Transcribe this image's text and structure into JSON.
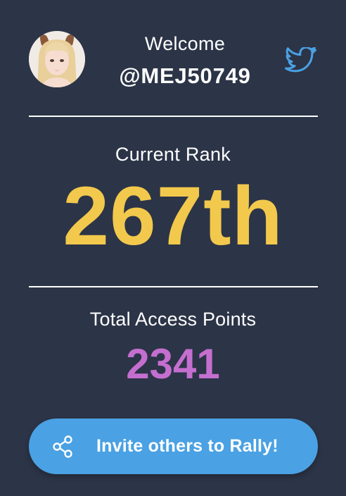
{
  "colors": {
    "background": "#2c3447",
    "rank": "#f2c94c",
    "points": "#c46fcf",
    "button": "#4aa1e3",
    "twitter": "#4aa1e3"
  },
  "profile": {
    "avatar_icon": "user-avatar",
    "welcome_text": "Welcome",
    "username": "@MEJ50749",
    "social_icon": "twitter-icon"
  },
  "rank": {
    "label": "Current Rank",
    "value": "267th"
  },
  "points": {
    "label": "Total Access Points",
    "value": "2341"
  },
  "invite": {
    "icon": "share-icon",
    "label": "Invite others to Rally!"
  }
}
